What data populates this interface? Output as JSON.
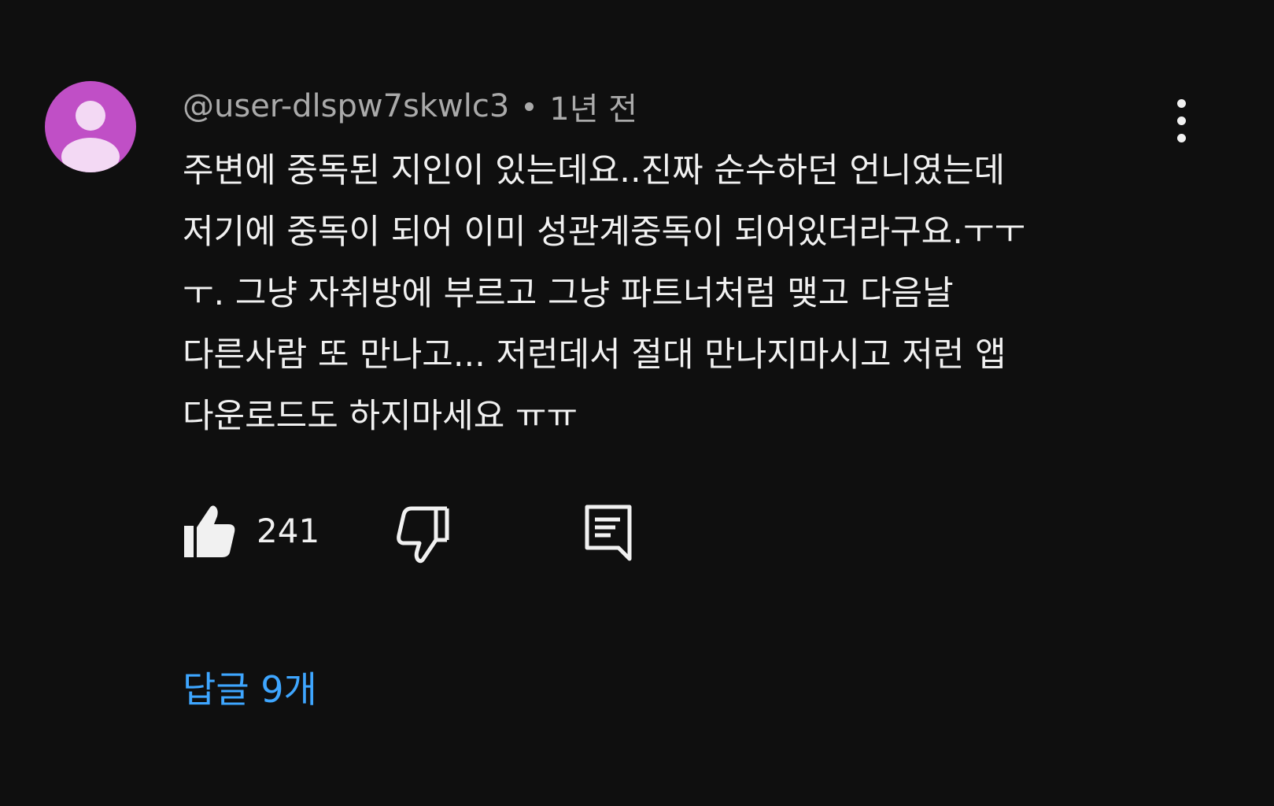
{
  "comment": {
    "author": "@user-dlspw7skwlc3",
    "time": "1년 전",
    "text_lines": [
      "주변에 중독된 지인이 있는데요..진짜 순수하던 언니였는데",
      "저기에 중독이 되어 이미 성관계중독이 되어있더라구요.ㅜㅜ",
      "ㅜ. 그냥 자취방에 부르고 그냥 파트너처럼 맺고 다음날",
      "다른사람 또 만나고... 저런데서 절대 만나지마시고 저런 앱",
      "다운로드도 하지마세요 ㅠㅠ"
    ],
    "like_count": "241",
    "replies_label": "답글 9개"
  },
  "icons": {
    "avatar": "default-user-avatar-icon",
    "more": "more-vertical-icon",
    "like": "thumbs-up-filled-icon",
    "dislike": "thumbs-down-outline-icon",
    "reply": "reply-comment-icon"
  },
  "colors": {
    "background": "#0f0f0f",
    "avatar_bg": "#c04fc6",
    "primary_text": "#f1f1f1",
    "secondary_text": "#aaaaaa",
    "link": "#3ea6ff"
  }
}
